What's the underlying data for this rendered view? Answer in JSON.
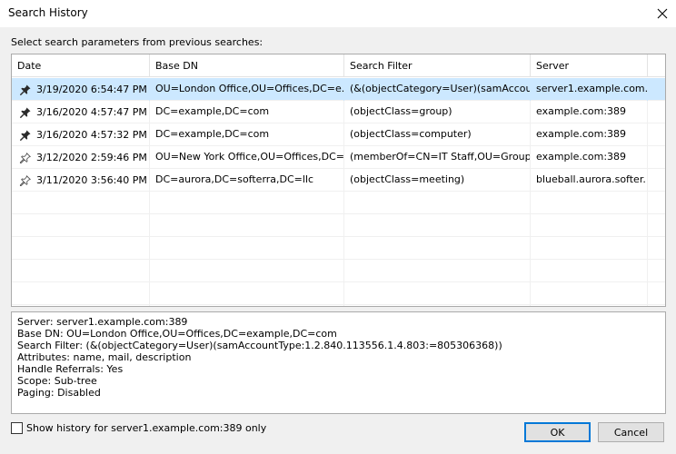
{
  "window": {
    "title": "Search History"
  },
  "prompt": "Select search parameters from previous searches:",
  "columns": [
    "Date",
    "Base DN",
    "Search Filter",
    "Server"
  ],
  "rows": [
    {
      "pinned": true,
      "date": "3/19/2020 6:54:47 PM",
      "base_dn": "OU=London Office,OU=Offices,DC=e...",
      "filter": "(&(objectCategory=User)(samAccou...",
      "server": "server1.example.com..."
    },
    {
      "pinned": true,
      "date": "3/16/2020 4:57:47 PM",
      "base_dn": "DC=example,DC=com",
      "filter": "(objectClass=group)",
      "server": "example.com:389"
    },
    {
      "pinned": true,
      "date": "3/16/2020 4:57:32 PM",
      "base_dn": "DC=example,DC=com",
      "filter": "(objectClass=computer)",
      "server": "example.com:389"
    },
    {
      "pinned": false,
      "date": "3/12/2020 2:59:46 PM",
      "base_dn": "OU=New York Office,OU=Offices,DC=...",
      "filter": "(memberOf=CN=IT Staff,OU=Group...",
      "server": "example.com:389"
    },
    {
      "pinned": false,
      "date": "3/11/2020 3:56:40 PM",
      "base_dn": "DC=aurora,DC=softerra,DC=llc",
      "filter": "(objectClass=meeting)",
      "server": "blueball.aurora.softer..."
    }
  ],
  "details": [
    "Server: server1.example.com:389",
    "Base DN: OU=London Office,OU=Offices,DC=example,DC=com",
    "Search Filter: (&(objectCategory=User)(samAccountType:1.2.840.113556.1.4.803:=805306368))",
    "Attributes: name, mail, description",
    "Handle Referrals: Yes",
    "Scope: Sub-tree",
    "Paging: Disabled"
  ],
  "checkbox": {
    "label": "Show history for server1.example.com:389 only",
    "checked": false
  },
  "buttons": {
    "ok": "OK",
    "cancel": "Cancel"
  },
  "colors": {
    "selected_row": "#cce8ff",
    "default_button_border": "#0078d7"
  },
  "icons": {
    "pinned": "pin-filled-icon",
    "unpinned": "pin-outline-icon",
    "close": "close-icon"
  }
}
